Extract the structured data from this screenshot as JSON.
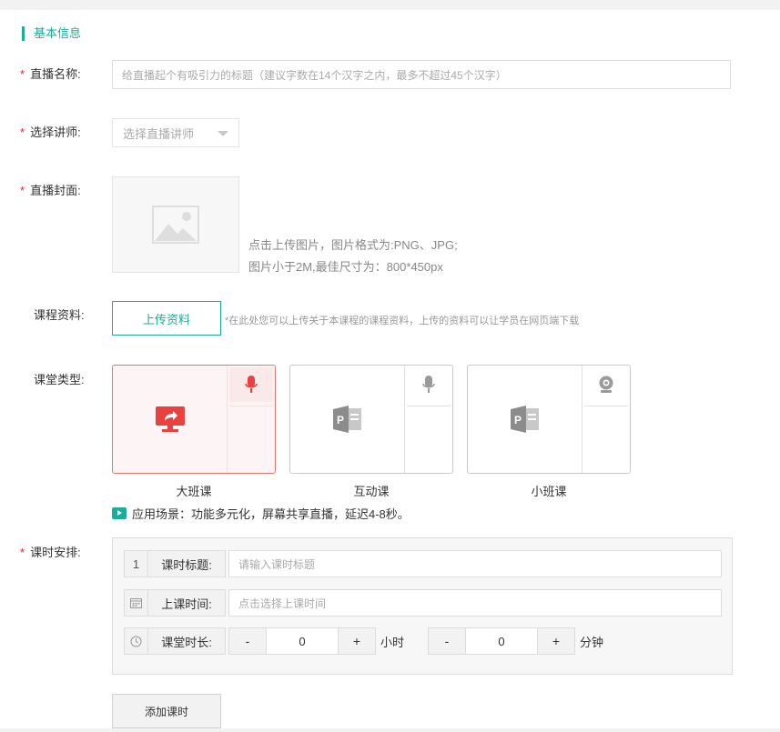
{
  "section": {
    "title": "基本信息"
  },
  "fields": {
    "name": {
      "label": "直播名称:",
      "placeholder": "给直播起个有吸引力的标题（建议字数在14个汉字之内，最多不超过45个汉字）"
    },
    "teacher": {
      "label": "选择讲师:",
      "value": "选择直播讲师"
    },
    "cover": {
      "label": "直播封面:",
      "hint1": "点击上传图片，图片格式为:PNG、JPG;",
      "hint2": "图片小于2M,最佳尺寸为：800*450px"
    },
    "material": {
      "label": "课程资料:",
      "button": "上传资料",
      "note": "*在此处您可以上传关于本课程的课程资料，上传的资料可以让学员在网页端下载"
    },
    "room_type": {
      "label": "课堂类型:",
      "options": [
        {
          "name": "大班课",
          "selected": true,
          "icon": "screen-share-icon",
          "side_icon": "microphone-icon"
        },
        {
          "name": "互动课",
          "selected": false,
          "icon": "powerpoint-icon",
          "side_icon": "microphone-icon"
        },
        {
          "name": "小班课",
          "selected": false,
          "icon": "powerpoint-icon",
          "side_icon": "webcam-icon"
        }
      ],
      "scene": "应用场景：功能多元化，屏幕共享直播，延迟4-8秒。"
    },
    "schedule": {
      "label": "课时安排:",
      "index": "1",
      "title_label": "课时标题:",
      "title_placeholder": "请输入课时标题",
      "time_label": "上课时间:",
      "time_placeholder": "点击选择上课时间",
      "duration_label": "课堂时长:",
      "hours": "0",
      "hours_unit": "小时",
      "minutes": "0",
      "minutes_unit": "分钟",
      "minus": "-",
      "plus": "+"
    },
    "add_lesson": "添加课时"
  },
  "colors": {
    "accent": "#1aad9a",
    "required": "#e02020",
    "selected_border": "#f07070",
    "selected_icon": "#e8413f"
  }
}
